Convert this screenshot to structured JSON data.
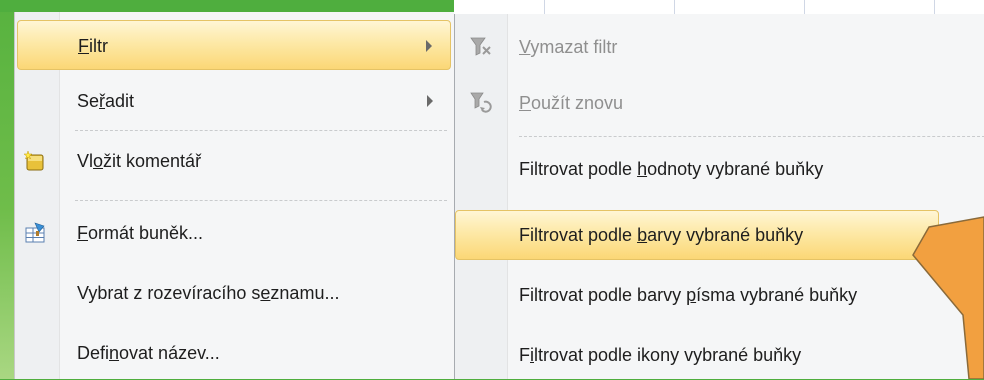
{
  "context_menu": {
    "items": [
      {
        "pre": "",
        "key": "F",
        "post": "iltr",
        "has_submenu": true,
        "highlighted": true,
        "icon": "none"
      },
      {
        "pre": "Se",
        "key": "ř",
        "post": "adit",
        "has_submenu": true,
        "highlighted": false,
        "icon": "none"
      },
      {
        "pre": "Vl",
        "key": "o",
        "post": "žit komentář",
        "has_submenu": false,
        "highlighted": false,
        "icon": "new-comment-icon"
      },
      {
        "pre": "",
        "key": "F",
        "post": "ormát buněk...",
        "has_submenu": false,
        "highlighted": false,
        "icon": "format-cells-icon"
      },
      {
        "pre": "Vybrat z rozevíracího s",
        "key": "e",
        "post": "znamu...",
        "has_submenu": false,
        "highlighted": false,
        "icon": "none"
      },
      {
        "pre": "Defi",
        "key": "n",
        "post": "ovat název...",
        "has_submenu": false,
        "highlighted": false,
        "icon": "none"
      }
    ]
  },
  "filter_submenu": {
    "items": [
      {
        "pre": "",
        "key": "V",
        "post": "ymazat filtr",
        "enabled": false,
        "highlighted": false,
        "icon": "clear-filter-icon"
      },
      {
        "pre": "",
        "key": "P",
        "post": "oužít znovu",
        "enabled": false,
        "highlighted": false,
        "icon": "reapply-filter-icon"
      },
      {
        "pre": "Filtrovat podle ",
        "key": "h",
        "post": "odnoty vybrané buňky",
        "enabled": true,
        "highlighted": false,
        "icon": "none"
      },
      {
        "pre": "Filtrovat podle ",
        "key": "b",
        "post": "arvy vybrané buňky",
        "enabled": true,
        "highlighted": true,
        "icon": "none"
      },
      {
        "pre": "Filtrovat podle barvy ",
        "key": "p",
        "post": "ísma vybrané buňky",
        "enabled": true,
        "highlighted": false,
        "icon": "none"
      },
      {
        "pre": "F",
        "key": "i",
        "post": "ltrovat podle ikony vybrané buňky",
        "enabled": true,
        "highlighted": false,
        "icon": "none"
      }
    ]
  },
  "colors": {
    "background": "#4fae3e",
    "highlight": "#fde9a7",
    "callout": "#f2a040"
  }
}
